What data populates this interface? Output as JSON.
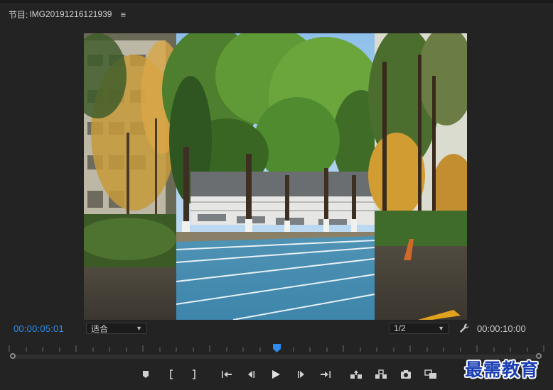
{
  "panel": {
    "title_prefix": "节目:",
    "sequence_name": "IMG20191216121939",
    "menu_icon": "hamburger-icon"
  },
  "timecode": {
    "current": "00:00:05:01",
    "duration": "00:00:10:00"
  },
  "controls": {
    "fit_select": "适合",
    "resolution_select": "1/2"
  },
  "playhead_position": 0.5,
  "transport_icons": [
    "add-marker-icon",
    "mark-in-icon",
    "mark-out-icon",
    "go-to-in-icon",
    "step-back-icon",
    "play-icon",
    "step-forward-icon",
    "go-to-out-icon",
    "lift-icon",
    "extract-icon",
    "export-frame-icon",
    "comparison-view-icon"
  ],
  "colors": {
    "background": "#232323",
    "accent": "#2d8ceb",
    "text": "#c8c8c8"
  },
  "watermark": "最需教育"
}
